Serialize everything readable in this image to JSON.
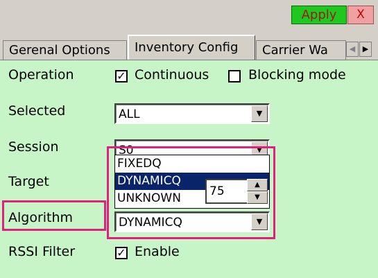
{
  "toolbar": {
    "apply_label": "Apply",
    "close_label": "X"
  },
  "tabs": [
    {
      "label": "Gerenal Options",
      "active": false
    },
    {
      "label": "Inventory Config",
      "active": true
    },
    {
      "label": "Carrier Wa",
      "active": false
    }
  ],
  "tab_arrows": {
    "left": "◀",
    "right": "▶"
  },
  "form": {
    "operation": {
      "label": "Operation",
      "continuous": {
        "label": "Continuous",
        "checked": true
      },
      "blocking": {
        "label": "Blocking mode",
        "checked": false
      }
    },
    "selected": {
      "label": "Selected",
      "value": "ALL"
    },
    "session": {
      "label": "Session",
      "value": "S0"
    },
    "target": {
      "label": "Target"
    },
    "algorithm": {
      "label": "Algorithm",
      "value": "DYNAMICQ"
    },
    "rssi": {
      "label": "RSSI Filter",
      "enable": {
        "label": "Enable",
        "checked": true
      },
      "value": "75"
    }
  },
  "dropdown": {
    "options": [
      "FIXEDQ",
      "DYNAMICQ",
      "UNKNOWN"
    ],
    "selected_index": 1
  },
  "glyphs": {
    "check": "✓",
    "down": "▼",
    "up": "▲"
  },
  "colors": {
    "apply_bg": "#1fc71f",
    "panel_bg": "#c8f5c8",
    "highlight": "#e0207a",
    "selection": "#0a246a"
  }
}
